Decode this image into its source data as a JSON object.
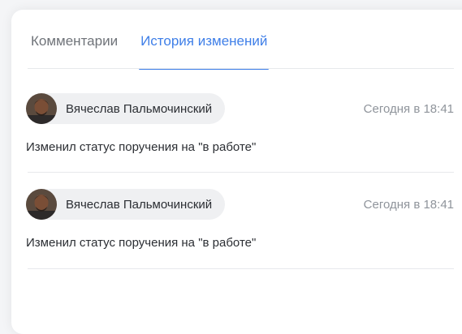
{
  "tabs": {
    "comments": "Комментарии",
    "history": "История изменений",
    "active": "history"
  },
  "history": [
    {
      "author": "Вячеслав Пальмочинский",
      "time": "Сегодня в 18:41",
      "text": "Изменил статус поручения на \"в работе\""
    },
    {
      "author": "Вячеслав Пальмочинский",
      "time": "Сегодня в 18:41",
      "text": "Изменил статус поручения на \"в работе\""
    }
  ],
  "colors": {
    "accent": "#3f7fe8",
    "chip_background": "#eff0f2",
    "muted_text": "#8f949b"
  }
}
